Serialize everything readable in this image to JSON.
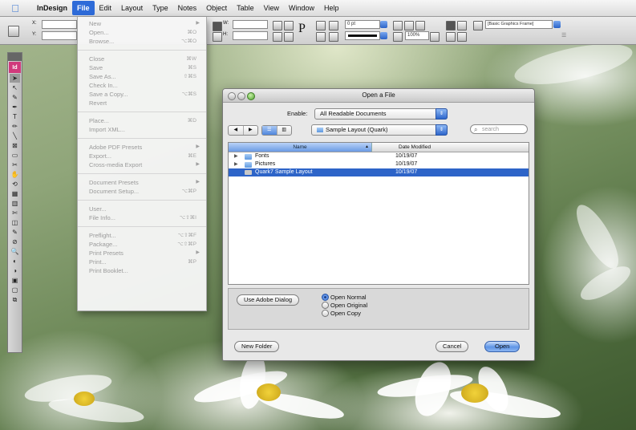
{
  "menubar": {
    "apple_icon": "apple-icon",
    "items": [
      "InDesign",
      "File",
      "Edit",
      "Layout",
      "Type",
      "Notes",
      "Object",
      "Table",
      "View",
      "Window",
      "Help"
    ],
    "active": "File"
  },
  "controlbar": {
    "x_label": "X:",
    "y_label": "Y:",
    "w_label": "W:",
    "h_label": "H:",
    "stroke_weight": "0 pt",
    "zoom": "100%",
    "object_style": "[Basic Graphics Frame]"
  },
  "toolbox": {
    "badge": "Id",
    "tools": [
      "➤",
      "↖",
      "✎",
      "✒",
      "T",
      "✏",
      "╲",
      "⊠",
      "▭",
      "✂",
      "✋",
      "⟲",
      "▦",
      "▥",
      "✄",
      "◫",
      "✎",
      "⊘",
      "🔍",
      "◐",
      "◑",
      "▣",
      "▢",
      "⧉"
    ]
  },
  "file_menu": {
    "groups": [
      [
        {
          "label": "New",
          "shortcut": "",
          "submenu": true
        },
        {
          "label": "Open...",
          "shortcut": "⌘O"
        },
        {
          "label": "Browse...",
          "shortcut": "⌥⌘O"
        }
      ],
      [
        {
          "label": "Close",
          "shortcut": "⌘W"
        },
        {
          "label": "Save",
          "shortcut": "⌘S"
        },
        {
          "label": "Save As...",
          "shortcut": "⇧⌘S"
        },
        {
          "label": "Check In...",
          "shortcut": ""
        },
        {
          "label": "Save a Copy...",
          "shortcut": "⌥⌘S"
        },
        {
          "label": "Revert",
          "shortcut": ""
        }
      ],
      [
        {
          "label": "Place...",
          "shortcut": "⌘D"
        },
        {
          "label": "Import XML...",
          "shortcut": ""
        }
      ],
      [
        {
          "label": "Adobe PDF Presets",
          "shortcut": "",
          "submenu": true
        },
        {
          "label": "Export...",
          "shortcut": "⌘E"
        },
        {
          "label": "Cross-media Export",
          "shortcut": "",
          "submenu": true
        }
      ],
      [
        {
          "label": "Document Presets",
          "shortcut": "",
          "submenu": true
        },
        {
          "label": "Document Setup...",
          "shortcut": "⌥⌘P"
        }
      ],
      [
        {
          "label": "User...",
          "shortcut": ""
        },
        {
          "label": "File Info...",
          "shortcut": "⌥⇧⌘I"
        }
      ],
      [
        {
          "label": "Preflight...",
          "shortcut": "⌥⇧⌘F"
        },
        {
          "label": "Package...",
          "shortcut": "⌥⇧⌘P"
        },
        {
          "label": "Print Presets",
          "shortcut": "",
          "submenu": true
        },
        {
          "label": "Print...",
          "shortcut": "⌘P"
        },
        {
          "label": "Print Booklet...",
          "shortcut": ""
        }
      ]
    ]
  },
  "dialog": {
    "title": "Open a File",
    "enable_label": "Enable:",
    "enable_value": "All Readable Documents",
    "location": "Sample Layout (Quark)",
    "search_placeholder": "search",
    "columns": {
      "name": "Name",
      "date": "Date Modified"
    },
    "files": [
      {
        "name": "Fonts",
        "date": "10/19/07",
        "kind": "folder",
        "selected": false
      },
      {
        "name": "Pictures",
        "date": "10/19/07",
        "kind": "folder",
        "selected": false
      },
      {
        "name": "Quark7 Sample Layout",
        "date": "10/19/07",
        "kind": "document",
        "selected": true
      }
    ],
    "use_adobe_dialog": "Use Adobe Dialog",
    "open_options": [
      "Open Normal",
      "Open Original",
      "Open Copy"
    ],
    "open_selected": "Open Normal",
    "new_folder": "New Folder",
    "cancel": "Cancel",
    "open": "Open"
  }
}
